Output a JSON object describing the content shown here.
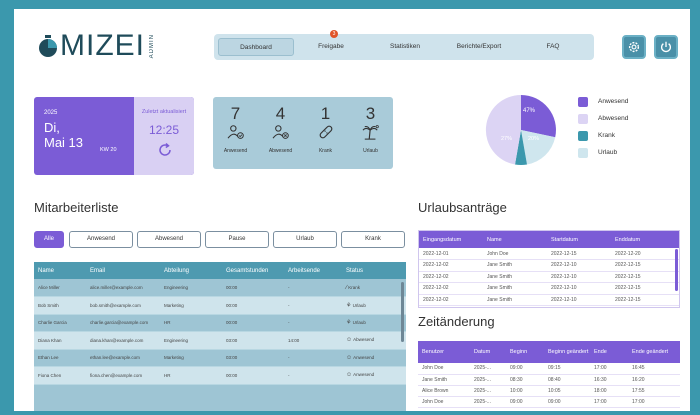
{
  "app": {
    "logo_text": "MIZEI",
    "logo_sub": "ADMIN"
  },
  "nav": {
    "items": [
      "Dashboard",
      "Freigabe",
      "Statistiken",
      "Berichte/Export",
      "FAQ"
    ],
    "freigabe_badge": "3"
  },
  "date_card": {
    "year": "2025",
    "weekday": "Di,",
    "date": "Mai 13",
    "week": "KW 20",
    "updated_label": "Zuletzt aktualisiert",
    "updated_time": "12:25"
  },
  "stats": [
    {
      "value": "7",
      "label": "Anwesend",
      "icon": "person-check-icon"
    },
    {
      "value": "4",
      "label": "Abwesend",
      "icon": "person-x-icon"
    },
    {
      "value": "1",
      "label": "Krank",
      "icon": "bandage-icon"
    },
    {
      "value": "3",
      "label": "Urlaub",
      "icon": "palm-tree-icon"
    }
  ],
  "pie": {
    "labels": {
      "anwesend": "47%",
      "abwesend": "27%",
      "urlaub": "20%"
    },
    "legend": [
      {
        "label": "Anwesend",
        "color": "#7b5cd6"
      },
      {
        "label": "Abwesend",
        "color": "#dcd4f4"
      },
      {
        "label": "Krank",
        "color": "#3b98ad"
      },
      {
        "label": "Urlaub",
        "color": "#cfe6ee"
      }
    ]
  },
  "employees": {
    "title": "Mitarbeiterliste",
    "filters": [
      "Alle",
      "Anwesend",
      "Abwesend",
      "Pause",
      "Urlaub",
      "Krank"
    ],
    "columns": [
      "Name",
      "Email",
      "Abteilung",
      "Gesamtstunden",
      "Arbeitsende",
      "Status"
    ],
    "rows": [
      [
        "Alice Miller",
        "alice.miller@example.com",
        "Engineering",
        "00:00",
        "-",
        "Krank"
      ],
      [
        "Bob Smith",
        "bob.smith@example.com",
        "Marketing",
        "00:00",
        "-",
        "Urlaub"
      ],
      [
        "Charlie Garcia",
        "charlie.garcia@example.com",
        "HR",
        "00:00",
        "-",
        "Urlaub"
      ],
      [
        "Diana Khan",
        "diana.khan@example.com",
        "Engineering",
        "03:00",
        "14:00",
        "Abwesend"
      ],
      [
        "Ethan Lee",
        "ethan.lee@example.com",
        "Marketing",
        "03:00",
        "-",
        "Anwesend"
      ],
      [
        "Fiona Chen",
        "fiona.chen@example.com",
        "HR",
        "00:00",
        "-",
        "Anwesend"
      ]
    ]
  },
  "vacation": {
    "title": "Urlaubsanträge",
    "columns": [
      "Eingangsdatum",
      "Name",
      "Startdatum",
      "Enddatum"
    ],
    "rows": [
      [
        "2022-12-01",
        "John Doe",
        "2022-12-15",
        "2022-12-20"
      ],
      [
        "2022-12-02",
        "Jane Smith",
        "2022-12-10",
        "2022-12-15"
      ],
      [
        "2022-12-02",
        "Jane Smith",
        "2022-12-10",
        "2022-12-15"
      ],
      [
        "2022-12-02",
        "Jane Smith",
        "2022-12-10",
        "2022-12-15"
      ],
      [
        "2022-12-02",
        "Jane Smith",
        "2022-12-10",
        "2022-12-15"
      ]
    ]
  },
  "changes": {
    "title": "Zeitänderung",
    "columns": [
      "Benutzer",
      "Datum",
      "Beginn",
      "Beginn geändert",
      "Ende",
      "Ende geändert"
    ],
    "rows": [
      [
        "John Doe",
        "2025-...",
        "09:00",
        "09:15",
        "17:00",
        "16:45"
      ],
      [
        "Jane Smith",
        "2025-...",
        "08:30",
        "08:40",
        "16:30",
        "16:20"
      ],
      [
        "Alice Brown",
        "2025-...",
        "10:00",
        "10:05",
        "18:00",
        "17:55"
      ],
      [
        "John Doe",
        "2025-...",
        "09:00",
        "09:00",
        "17:00",
        "17:00"
      ]
    ]
  }
}
